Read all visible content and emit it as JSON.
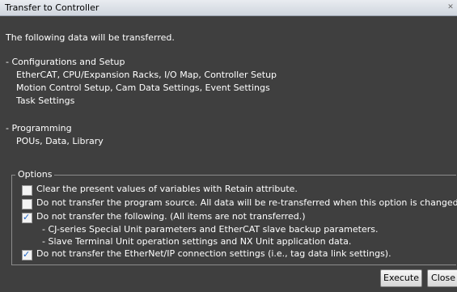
{
  "window": {
    "title": "Transfer to Controller"
  },
  "intro_text": "The following data will be transferred.",
  "sections": [
    {
      "heading": "- Configurations and Setup",
      "items": [
        "EtherCAT, CPU/Expansion Racks, I/O Map, Controller Setup",
        "Motion Control Setup, Cam Data Settings, Event Settings",
        "Task Settings"
      ]
    },
    {
      "heading": "- Programming",
      "items": [
        "POUs, Data, Library"
      ]
    }
  ],
  "options": {
    "legend": "Options",
    "items": [
      {
        "label": "Clear the present values of variables with Retain attribute.",
        "checked": false
      },
      {
        "label": "Do not transfer the program source. All data will be re-transferred when this option is changed.",
        "checked": false
      },
      {
        "label": "Do not transfer the following. (All items are not transferred.)",
        "checked": true,
        "subitems": [
          "- CJ-series Special Unit parameters and EtherCAT slave backup parameters.",
          "- Slave Terminal Unit operation settings and NX Unit application data."
        ]
      },
      {
        "label": "Do not transfer the EtherNet/IP connection settings (i.e., tag data link settings).",
        "checked": true
      }
    ]
  },
  "buttons": {
    "execute": "Execute",
    "close": "Close"
  }
}
